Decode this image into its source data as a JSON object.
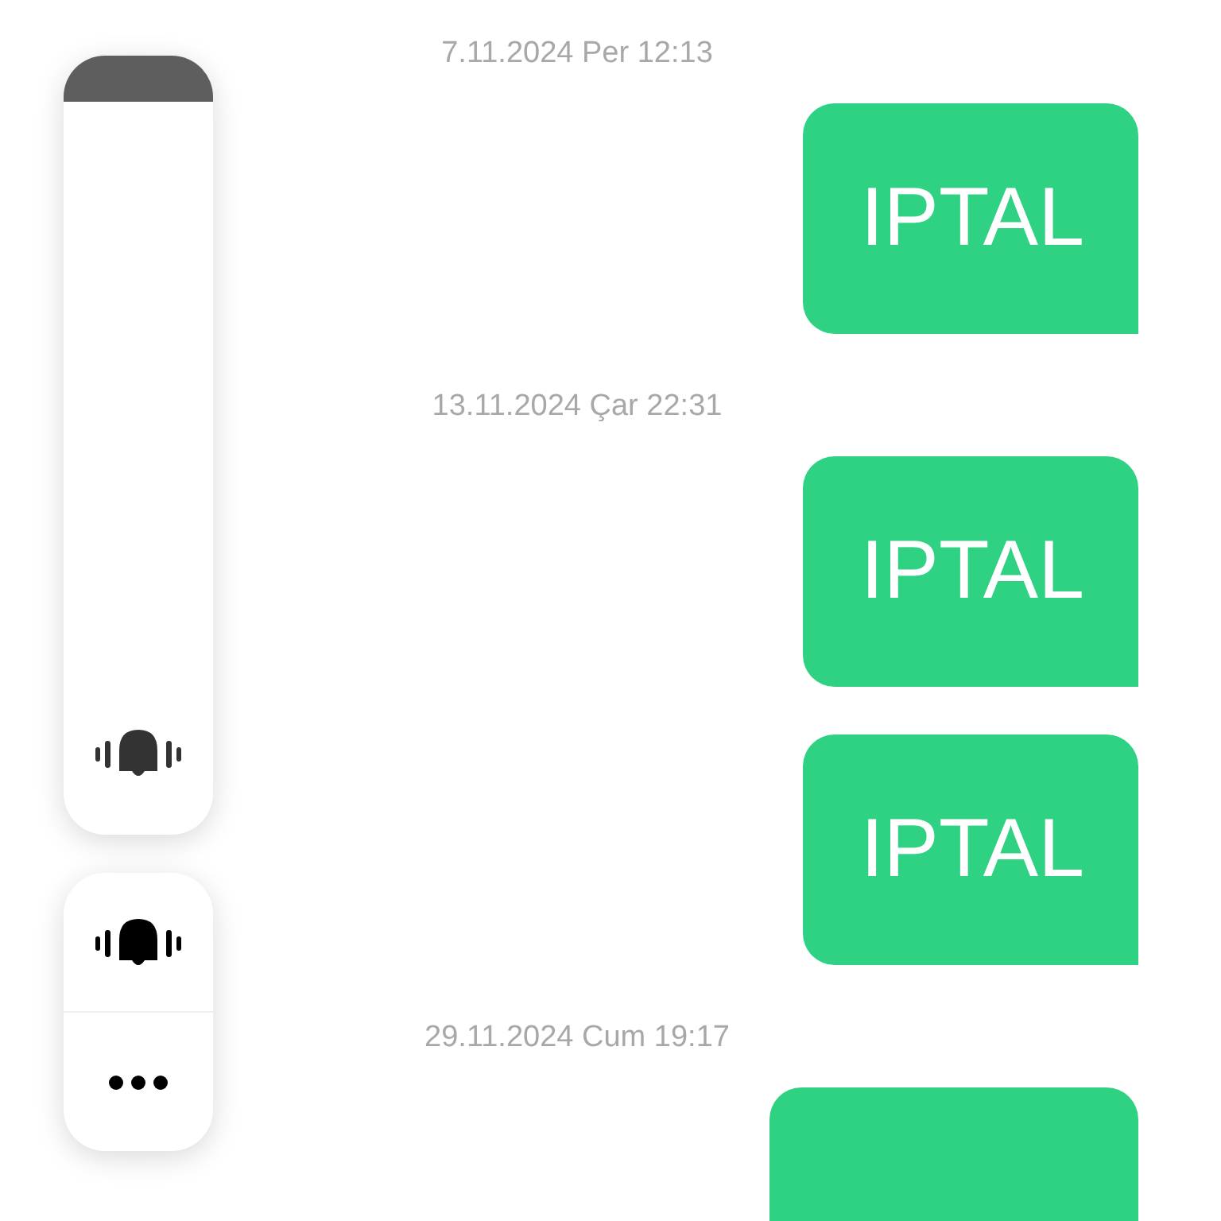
{
  "messages": [
    {
      "kind": "timestamp",
      "text": "7.11.2024 Per 12:13"
    },
    {
      "kind": "bubble",
      "text": "IPTAL"
    },
    {
      "kind": "timestamp",
      "text": "13.11.2024 Çar 22:31"
    },
    {
      "kind": "bubble",
      "text": "IPTAL"
    },
    {
      "kind": "bubble",
      "text": "IPTAL"
    },
    {
      "kind": "timestamp",
      "text": "29.11.2024 Cum 19:17"
    },
    {
      "kind": "bubble"
    }
  ],
  "volume_panel": {
    "slider": {
      "level": 0.06
    }
  }
}
